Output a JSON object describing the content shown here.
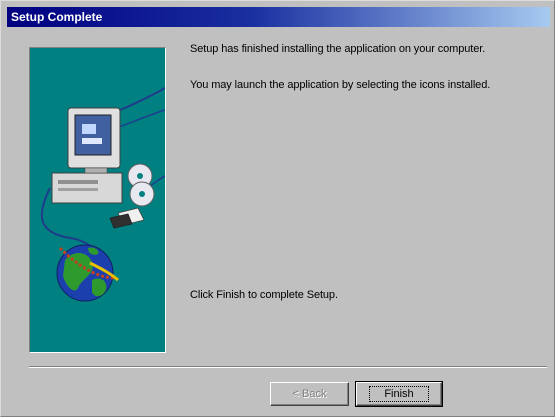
{
  "window": {
    "title": "Setup Complete"
  },
  "messages": {
    "line1": "Setup has finished installing the application on your computer.",
    "line2": "You may launch the application by selecting the icons installed.",
    "line3": "Click Finish to complete Setup."
  },
  "buttons": {
    "back_label": "< Back",
    "back_enabled": false,
    "finish_label": "Finish",
    "finish_default": true
  },
  "illustration": {
    "description_icons": [
      "computer-icon",
      "cd-icon",
      "floppy-disk-icon",
      "globe-icon"
    ],
    "background": "#008080"
  },
  "colors": {
    "titlebar_start": "#000080",
    "titlebar_end": "#a6caf0",
    "dialog_bg": "#c0c0c0",
    "panel_bg": "#008080"
  }
}
